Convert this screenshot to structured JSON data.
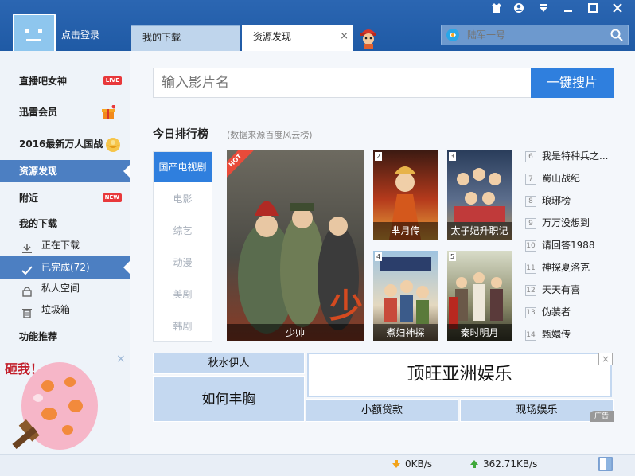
{
  "header": {
    "login_label": "点击登录",
    "tabs": [
      {
        "label": "我的下载"
      },
      {
        "label": "资源发现",
        "close": "×"
      }
    ],
    "search_placeholder": "陆军一号",
    "window_controls": [
      "shirt-icon",
      "account-icon",
      "menu-icon",
      "minimize-icon",
      "close-icon"
    ]
  },
  "sidebar": {
    "items": [
      {
        "label": "直播吧女神",
        "badge": "LIVE"
      },
      {
        "label": "迅雷会员"
      },
      {
        "label": "2016最新万人国战"
      },
      {
        "label": "资源发现"
      },
      {
        "label": "附近",
        "badge": "NEW"
      },
      {
        "label": "我的下载"
      },
      {
        "label": "正在下载"
      },
      {
        "label": "已完成(72)"
      },
      {
        "label": "私人空间"
      },
      {
        "label": "垃圾箱"
      },
      {
        "label": "功能推荐"
      }
    ],
    "promo_text": "砸我！",
    "promo_close": "×"
  },
  "main": {
    "search_placeholder": "输入影片名",
    "search_button": "一键搜片",
    "ranking_title": "今日排行榜",
    "ranking_source": "(数据来源百度风云榜)",
    "categories": [
      "国产电视剧",
      "电影",
      "综艺",
      "动漫",
      "美剧",
      "韩剧"
    ],
    "posters": [
      {
        "title": "少帅",
        "tag": "HOT"
      },
      {
        "title": "芈月传",
        "num": "2"
      },
      {
        "title": "太子妃升职记",
        "num": "3"
      },
      {
        "title": "煮妇神探",
        "num": "4"
      },
      {
        "title": "秦时明月",
        "num": "5"
      }
    ],
    "ranking_list": [
      {
        "num": "6",
        "title": "我是特种兵之..."
      },
      {
        "num": "7",
        "title": "蜀山战纪"
      },
      {
        "num": "8",
        "title": "琅琊榜"
      },
      {
        "num": "9",
        "title": "万万没想到"
      },
      {
        "num": "10",
        "title": "请回答1988"
      },
      {
        "num": "11",
        "title": "神探夏洛克"
      },
      {
        "num": "12",
        "title": "天天有喜"
      },
      {
        "num": "13",
        "title": "伪装者"
      },
      {
        "num": "14",
        "title": "甄嬛传"
      }
    ],
    "ads": {
      "a1": "秋水伊人",
      "a2": "如何丰胸",
      "big": "顶旺亚洲娱乐",
      "a3": "小额贷款",
      "a4": "现场娱乐",
      "tag": "广告",
      "close": "×"
    }
  },
  "status": {
    "upload": "0KB/s",
    "download": "362.71KB/s"
  },
  "colors": {
    "accent": "#2f7fde",
    "titlebar": "#2361ad",
    "sidebar_active": "#4c7fc2"
  }
}
